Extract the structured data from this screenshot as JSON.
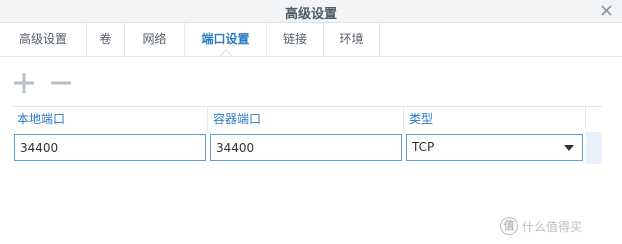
{
  "dialog": {
    "title": "高级设置",
    "close_icon": "close-icon"
  },
  "tabs": [
    {
      "label": "高级设置",
      "active": false
    },
    {
      "label": "卷",
      "active": false
    },
    {
      "label": "网络",
      "active": false
    },
    {
      "label": "端口设置",
      "active": true
    },
    {
      "label": "链接",
      "active": false
    },
    {
      "label": "环境",
      "active": false
    }
  ],
  "toolbar": {
    "add_icon": "plus-icon",
    "remove_icon": "minus-icon"
  },
  "table": {
    "columns": [
      "本地端口",
      "容器端口",
      "类型"
    ],
    "rows": [
      {
        "local_port": "34400",
        "container_port": "34400",
        "type": "TCP"
      }
    ]
  },
  "watermark": {
    "badge": "值",
    "text": "什么值得买"
  },
  "colors": {
    "accent": "#2b7ac4",
    "input_border": "#5aa0e0",
    "titlebar_bg": "#f2f4f6"
  }
}
